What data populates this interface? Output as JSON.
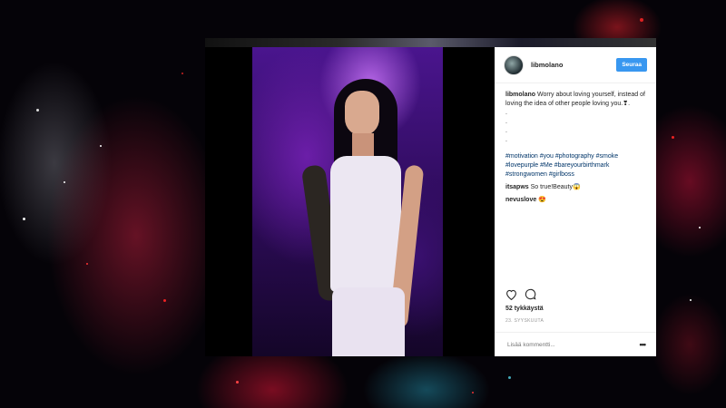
{
  "post": {
    "username": "libmolano",
    "follow_label": "Seuraa",
    "caption": "Worry about loving yourself, instead of loving the idea of other people loving you.❣.",
    "dots": [
      ".",
      ".",
      ".",
      "."
    ],
    "hashtags": "#motivation #you #photography #smoke #lovepurple #Me #bareyourbirthmark #strongwomen #girlboss",
    "comments": [
      {
        "user": "itsapws",
        "text": "So true!Beauty😱"
      },
      {
        "user": "nevuslove",
        "text": "😍"
      }
    ],
    "likes": "52 tykkäystä",
    "date": "23. SYYSKUUTA",
    "comment_placeholder": "Lisää kommentti...",
    "more_glyph": "•••"
  },
  "icons": [
    "heart-icon",
    "comment-icon",
    "more-options-icon"
  ],
  "colors": {
    "follow_button": "#3897f0",
    "hashtag": "#003569",
    "background": "#050308"
  }
}
